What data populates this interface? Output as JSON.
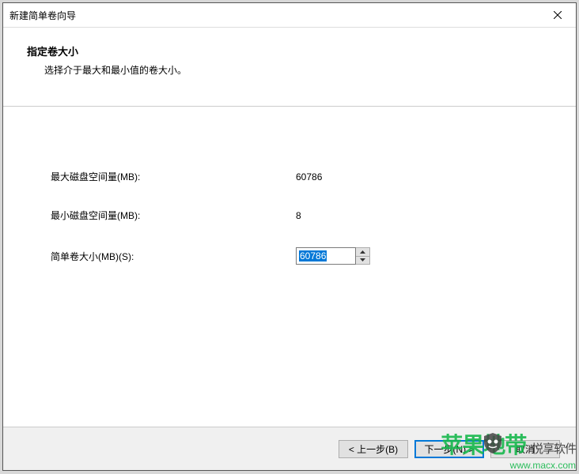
{
  "window": {
    "title": "新建简单卷向导"
  },
  "header": {
    "title": "指定卷大小",
    "subtitle": "选择介于最大和最小值的卷大小。"
  },
  "fields": {
    "max_label": "最大磁盘空间量(MB):",
    "max_value": "60786",
    "min_label": "最小磁盘空间量(MB):",
    "min_value": "8",
    "size_label": "简单卷大小(MB)(S):",
    "size_value": "60786"
  },
  "buttons": {
    "back": "< 上一步(B)",
    "next": "下一步(N) >",
    "cancel": "取消"
  },
  "watermark": {
    "brand1": "苹果地带",
    "brand2": "悦享软件",
    "url": "www.macx.com"
  }
}
